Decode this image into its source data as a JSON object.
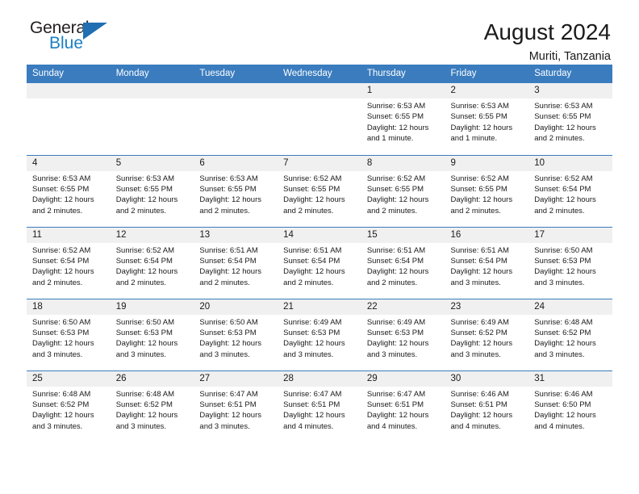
{
  "brand": {
    "name_top": "General",
    "name_bottom": "Blue",
    "accent_color": "#1b7fc4",
    "triangle_color": "#1f6fb2"
  },
  "header": {
    "title": "August 2024",
    "subtitle": "Muriti, Tanzania",
    "header_bg": "#3a7cbe"
  },
  "weekday_headers": [
    "Sunday",
    "Monday",
    "Tuesday",
    "Wednesday",
    "Thursday",
    "Friday",
    "Saturday"
  ],
  "labels": {
    "sunrise_prefix": "Sunrise: ",
    "sunset_prefix": "Sunset: ",
    "daylight_prefix": "Daylight: "
  },
  "weeks": [
    [
      {
        "day": "",
        "sunrise": "",
        "sunset": "",
        "daylight": "",
        "blank": true
      },
      {
        "day": "",
        "sunrise": "",
        "sunset": "",
        "daylight": "",
        "blank": true
      },
      {
        "day": "",
        "sunrise": "",
        "sunset": "",
        "daylight": "",
        "blank": true
      },
      {
        "day": "",
        "sunrise": "",
        "sunset": "",
        "daylight": "",
        "blank": true
      },
      {
        "day": "1",
        "sunrise": "Sunrise: 6:53 AM",
        "sunset": "Sunset: 6:55 PM",
        "daylight": "Daylight: 12 hours and 1 minute."
      },
      {
        "day": "2",
        "sunrise": "Sunrise: 6:53 AM",
        "sunset": "Sunset: 6:55 PM",
        "daylight": "Daylight: 12 hours and 1 minute."
      },
      {
        "day": "3",
        "sunrise": "Sunrise: 6:53 AM",
        "sunset": "Sunset: 6:55 PM",
        "daylight": "Daylight: 12 hours and 2 minutes."
      }
    ],
    [
      {
        "day": "4",
        "sunrise": "Sunrise: 6:53 AM",
        "sunset": "Sunset: 6:55 PM",
        "daylight": "Daylight: 12 hours and 2 minutes."
      },
      {
        "day": "5",
        "sunrise": "Sunrise: 6:53 AM",
        "sunset": "Sunset: 6:55 PM",
        "daylight": "Daylight: 12 hours and 2 minutes."
      },
      {
        "day": "6",
        "sunrise": "Sunrise: 6:53 AM",
        "sunset": "Sunset: 6:55 PM",
        "daylight": "Daylight: 12 hours and 2 minutes."
      },
      {
        "day": "7",
        "sunrise": "Sunrise: 6:52 AM",
        "sunset": "Sunset: 6:55 PM",
        "daylight": "Daylight: 12 hours and 2 minutes."
      },
      {
        "day": "8",
        "sunrise": "Sunrise: 6:52 AM",
        "sunset": "Sunset: 6:55 PM",
        "daylight": "Daylight: 12 hours and 2 minutes."
      },
      {
        "day": "9",
        "sunrise": "Sunrise: 6:52 AM",
        "sunset": "Sunset: 6:55 PM",
        "daylight": "Daylight: 12 hours and 2 minutes."
      },
      {
        "day": "10",
        "sunrise": "Sunrise: 6:52 AM",
        "sunset": "Sunset: 6:54 PM",
        "daylight": "Daylight: 12 hours and 2 minutes."
      }
    ],
    [
      {
        "day": "11",
        "sunrise": "Sunrise: 6:52 AM",
        "sunset": "Sunset: 6:54 PM",
        "daylight": "Daylight: 12 hours and 2 minutes."
      },
      {
        "day": "12",
        "sunrise": "Sunrise: 6:52 AM",
        "sunset": "Sunset: 6:54 PM",
        "daylight": "Daylight: 12 hours and 2 minutes."
      },
      {
        "day": "13",
        "sunrise": "Sunrise: 6:51 AM",
        "sunset": "Sunset: 6:54 PM",
        "daylight": "Daylight: 12 hours and 2 minutes."
      },
      {
        "day": "14",
        "sunrise": "Sunrise: 6:51 AM",
        "sunset": "Sunset: 6:54 PM",
        "daylight": "Daylight: 12 hours and 2 minutes."
      },
      {
        "day": "15",
        "sunrise": "Sunrise: 6:51 AM",
        "sunset": "Sunset: 6:54 PM",
        "daylight": "Daylight: 12 hours and 2 minutes."
      },
      {
        "day": "16",
        "sunrise": "Sunrise: 6:51 AM",
        "sunset": "Sunset: 6:54 PM",
        "daylight": "Daylight: 12 hours and 3 minutes."
      },
      {
        "day": "17",
        "sunrise": "Sunrise: 6:50 AM",
        "sunset": "Sunset: 6:53 PM",
        "daylight": "Daylight: 12 hours and 3 minutes."
      }
    ],
    [
      {
        "day": "18",
        "sunrise": "Sunrise: 6:50 AM",
        "sunset": "Sunset: 6:53 PM",
        "daylight": "Daylight: 12 hours and 3 minutes."
      },
      {
        "day": "19",
        "sunrise": "Sunrise: 6:50 AM",
        "sunset": "Sunset: 6:53 PM",
        "daylight": "Daylight: 12 hours and 3 minutes."
      },
      {
        "day": "20",
        "sunrise": "Sunrise: 6:50 AM",
        "sunset": "Sunset: 6:53 PM",
        "daylight": "Daylight: 12 hours and 3 minutes."
      },
      {
        "day": "21",
        "sunrise": "Sunrise: 6:49 AM",
        "sunset": "Sunset: 6:53 PM",
        "daylight": "Daylight: 12 hours and 3 minutes."
      },
      {
        "day": "22",
        "sunrise": "Sunrise: 6:49 AM",
        "sunset": "Sunset: 6:53 PM",
        "daylight": "Daylight: 12 hours and 3 minutes."
      },
      {
        "day": "23",
        "sunrise": "Sunrise: 6:49 AM",
        "sunset": "Sunset: 6:52 PM",
        "daylight": "Daylight: 12 hours and 3 minutes."
      },
      {
        "day": "24",
        "sunrise": "Sunrise: 6:48 AM",
        "sunset": "Sunset: 6:52 PM",
        "daylight": "Daylight: 12 hours and 3 minutes."
      }
    ],
    [
      {
        "day": "25",
        "sunrise": "Sunrise: 6:48 AM",
        "sunset": "Sunset: 6:52 PM",
        "daylight": "Daylight: 12 hours and 3 minutes."
      },
      {
        "day": "26",
        "sunrise": "Sunrise: 6:48 AM",
        "sunset": "Sunset: 6:52 PM",
        "daylight": "Daylight: 12 hours and 3 minutes."
      },
      {
        "day": "27",
        "sunrise": "Sunrise: 6:47 AM",
        "sunset": "Sunset: 6:51 PM",
        "daylight": "Daylight: 12 hours and 3 minutes."
      },
      {
        "day": "28",
        "sunrise": "Sunrise: 6:47 AM",
        "sunset": "Sunset: 6:51 PM",
        "daylight": "Daylight: 12 hours and 4 minutes."
      },
      {
        "day": "29",
        "sunrise": "Sunrise: 6:47 AM",
        "sunset": "Sunset: 6:51 PM",
        "daylight": "Daylight: 12 hours and 4 minutes."
      },
      {
        "day": "30",
        "sunrise": "Sunrise: 6:46 AM",
        "sunset": "Sunset: 6:51 PM",
        "daylight": "Daylight: 12 hours and 4 minutes."
      },
      {
        "day": "31",
        "sunrise": "Sunrise: 6:46 AM",
        "sunset": "Sunset: 6:50 PM",
        "daylight": "Daylight: 12 hours and 4 minutes."
      }
    ]
  ]
}
